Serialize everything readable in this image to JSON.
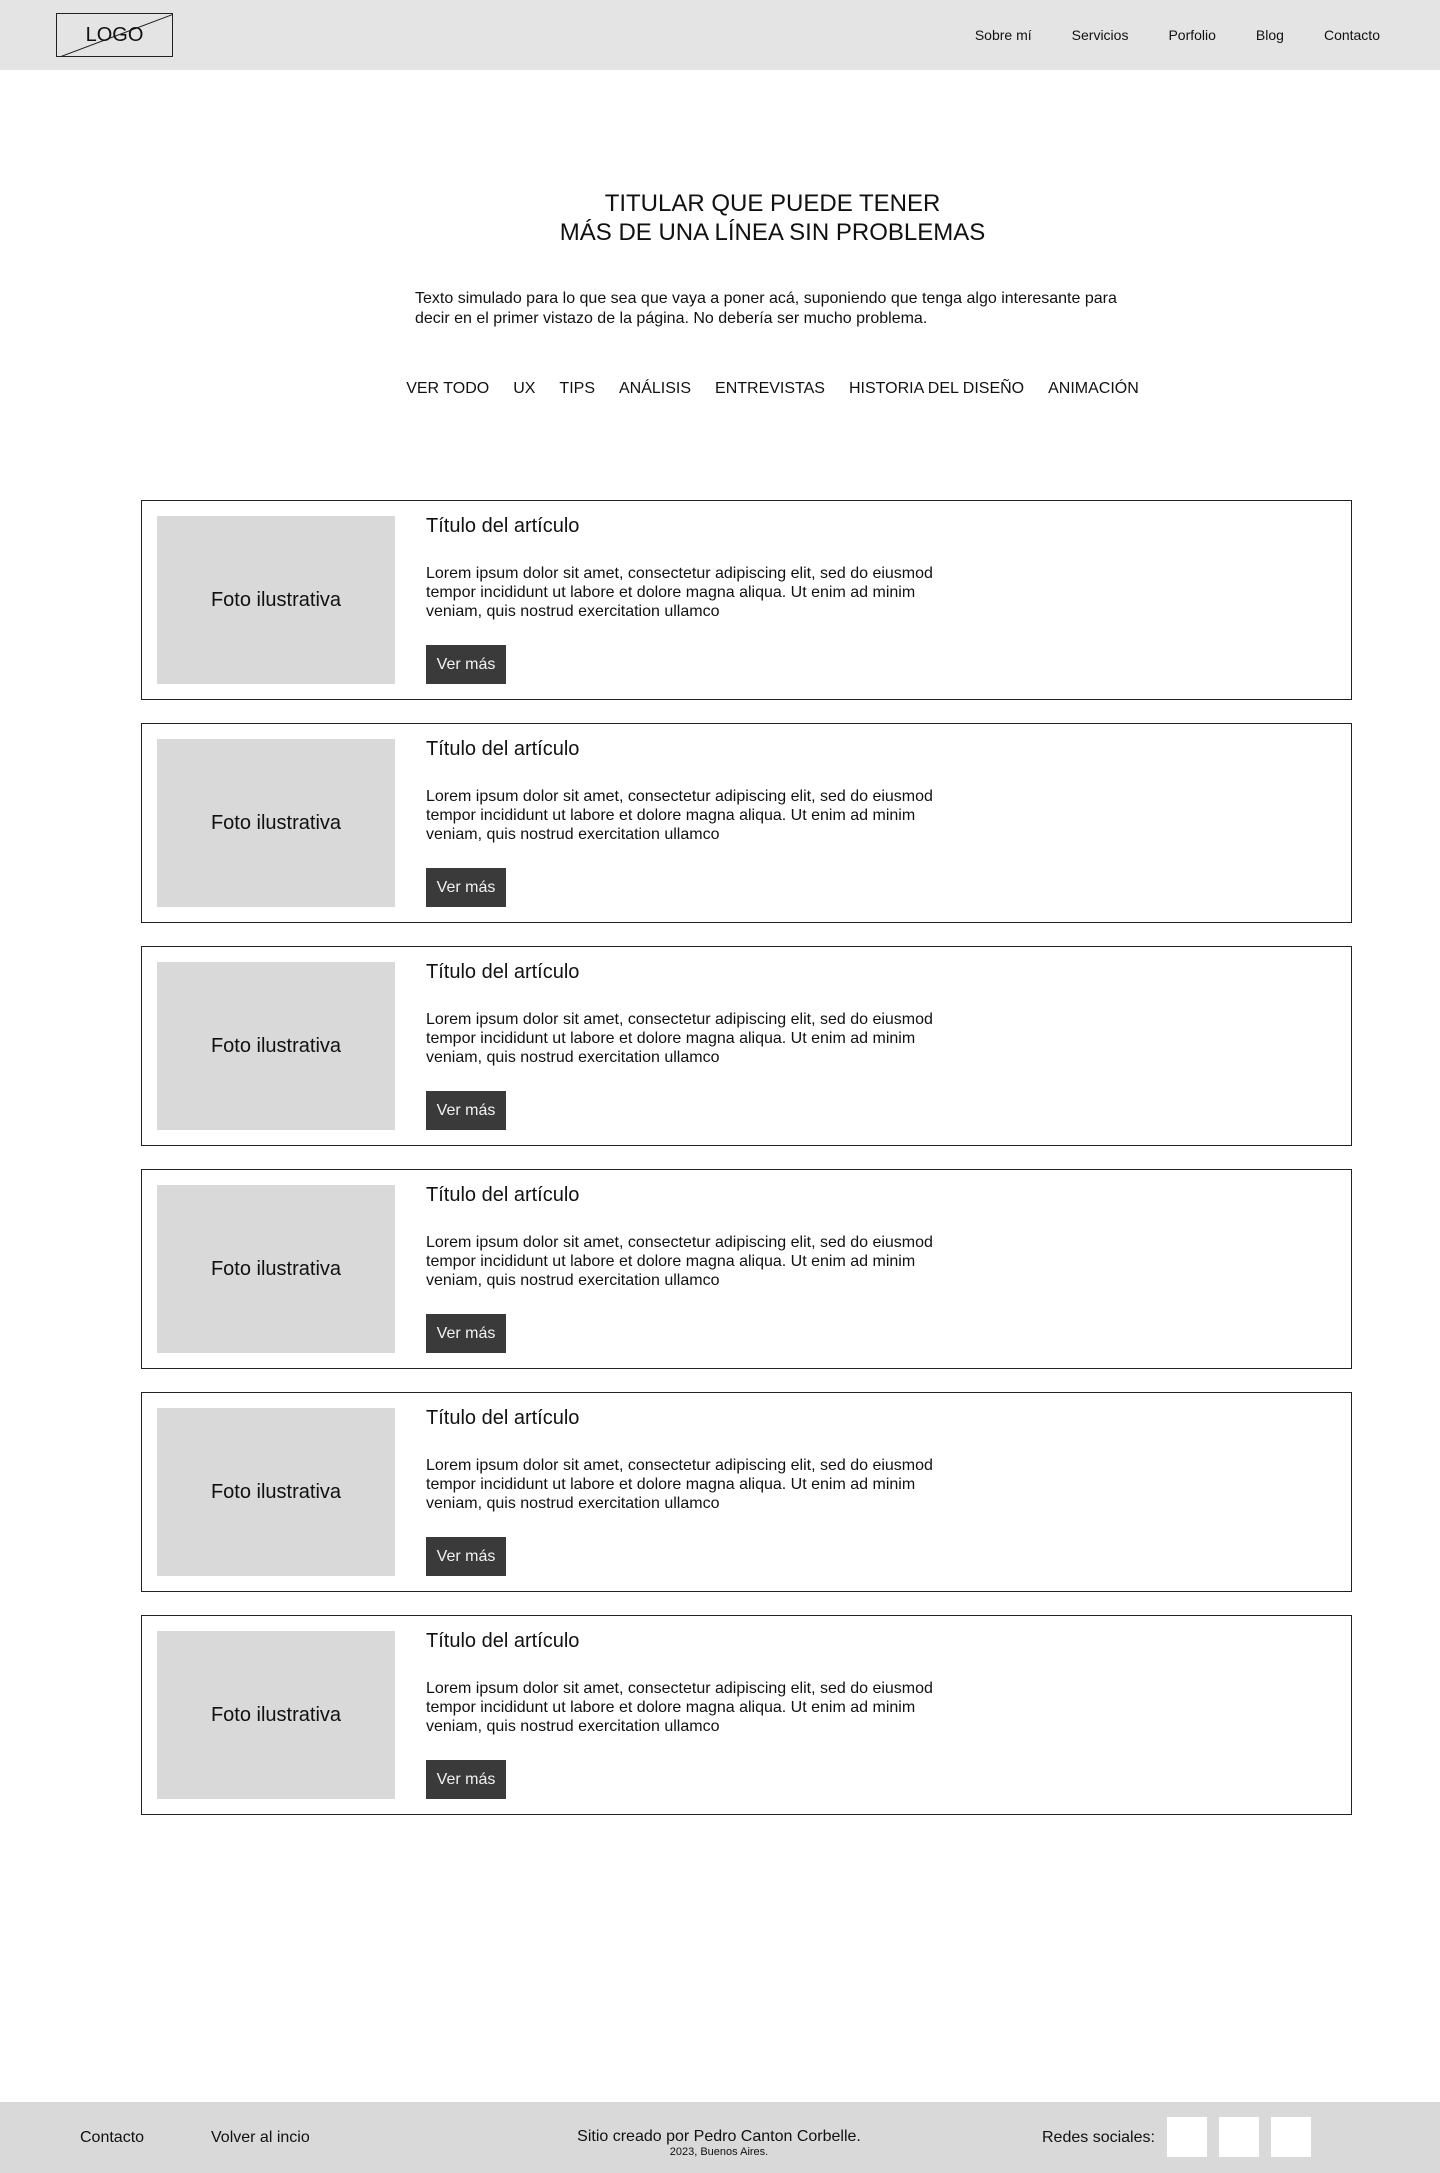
{
  "header": {
    "logo": "LOGO",
    "nav": [
      "Sobre mí",
      "Servicios",
      "Porfolio",
      "Blog",
      "Contacto"
    ]
  },
  "hero": {
    "title_line1": "TITULAR QUE PUEDE TENER",
    "title_line2": "MÁS DE UNA LÍNEA SIN PROBLEMAS",
    "text": "Texto simulado para lo que sea que vaya a poner acá, suponiendo que tenga algo interesante para decir en el primer vistazo de la página. No debería ser mucho problema."
  },
  "filters": [
    "VER TODO",
    "UX",
    "TIPS",
    "ANÁLISIS",
    "ENTREVISTAS",
    "HISTORIA DEL DISEÑO",
    "ANIMACIÓN"
  ],
  "articles": [
    {
      "photo": "Foto ilustrativa",
      "title": "Título del artículo",
      "text": "Lorem ipsum dolor sit amet, consectetur adipiscing elit, sed do eiusmod tempor incididunt ut labore et dolore magna aliqua. Ut enim ad minim veniam, quis nostrud exercitation ullamco",
      "button": "Ver más"
    },
    {
      "photo": "Foto ilustrativa",
      "title": "Título del artículo",
      "text": "Lorem ipsum dolor sit amet, consectetur adipiscing elit, sed do eiusmod tempor incididunt ut labore et dolore magna aliqua. Ut enim ad minim veniam, quis nostrud exercitation ullamco",
      "button": "Ver más"
    },
    {
      "photo": "Foto ilustrativa",
      "title": "Título del artículo",
      "text": "Lorem ipsum dolor sit amet, consectetur adipiscing elit, sed do eiusmod tempor incididunt ut labore et dolore magna aliqua. Ut enim ad minim veniam, quis nostrud exercitation ullamco",
      "button": "Ver más"
    },
    {
      "photo": "Foto ilustrativa",
      "title": "Título del artículo",
      "text": "Lorem ipsum dolor sit amet, consectetur adipiscing elit, sed do eiusmod tempor incididunt ut labore et dolore magna aliqua. Ut enim ad minim veniam, quis nostrud exercitation ullamco",
      "button": "Ver más"
    },
    {
      "photo": "Foto ilustrativa",
      "title": "Título del artículo",
      "text": "Lorem ipsum dolor sit amet, consectetur adipiscing elit, sed do eiusmod tempor incididunt ut labore et dolore magna aliqua. Ut enim ad minim veniam, quis nostrud exercitation ullamco",
      "button": "Ver más"
    },
    {
      "photo": "Foto ilustrativa",
      "title": "Título del artículo",
      "text": "Lorem ipsum dolor sit amet, consectetur adipiscing elit, sed do eiusmod tempor incididunt ut labore et dolore magna aliqua. Ut enim ad minim veniam, quis nostrud exercitation ullamco",
      "button": "Ver más"
    }
  ],
  "footer": {
    "contact": "Contacto",
    "back_home": "Volver al incio",
    "credit": "Sitio creado por Pedro Canton Corbelle.",
    "city": "2023, Buenos Aires.",
    "social_label": "Redes sociales:"
  }
}
